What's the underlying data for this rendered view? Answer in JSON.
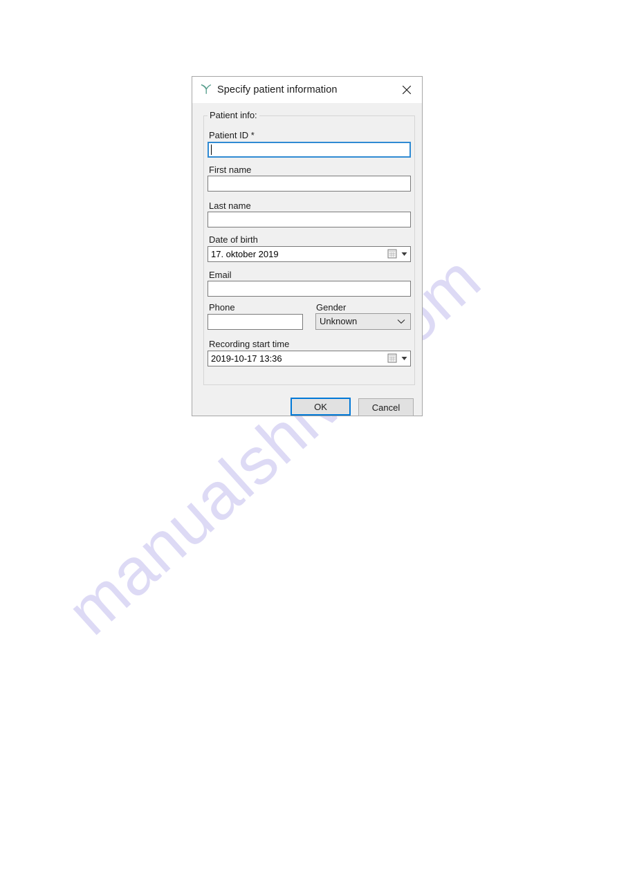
{
  "watermark": {
    "text": "manualshive.com"
  },
  "dialog": {
    "title": "Specify patient information",
    "icon": "tuning-fork-icon",
    "icon_color": "#5aa08f",
    "close_icon": "close-icon",
    "accent_color": "#0078d7",
    "focus_border_color": "#2f8ad3",
    "group": {
      "legend": "Patient info:"
    },
    "fields": {
      "patient_id": {
        "label": "Patient ID *",
        "value": "",
        "placeholder": ""
      },
      "first_name": {
        "label": "First name",
        "value": "",
        "placeholder": ""
      },
      "last_name": {
        "label": "Last name",
        "value": "",
        "placeholder": ""
      },
      "date_of_birth": {
        "label": "Date of birth",
        "value": "17.  oktober   2019"
      },
      "email": {
        "label": "Email",
        "value": "",
        "placeholder": ""
      },
      "phone": {
        "label": "Phone",
        "value": "",
        "placeholder": ""
      },
      "gender": {
        "label": "Gender",
        "value": "Unknown",
        "options": [
          "Unknown"
        ]
      },
      "recording_start_time": {
        "label": "Recording start time",
        "value": "2019-10-17 13:36"
      }
    },
    "buttons": {
      "ok": "OK",
      "cancel": "Cancel"
    }
  }
}
